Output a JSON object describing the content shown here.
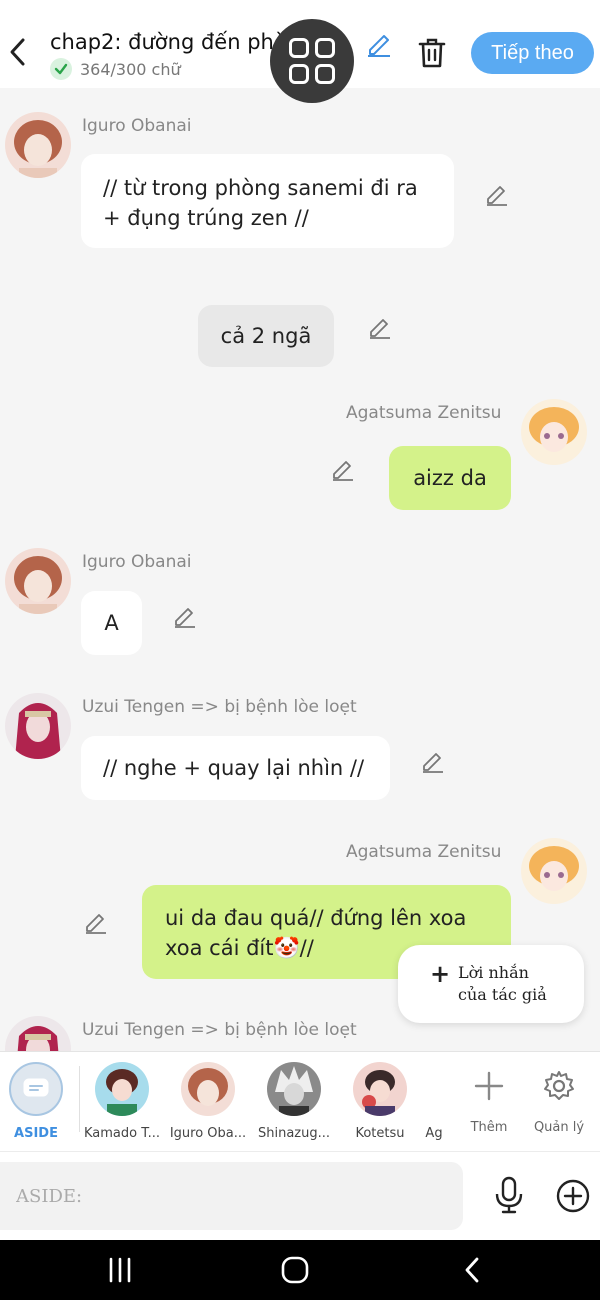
{
  "header": {
    "title": "chap2: đường đến phòng..",
    "word_count": "364/300 chữ",
    "next_label": "Tiếp theo",
    "next_color": "#5aaaf2"
  },
  "messages": [
    {
      "sender": "Iguro Obanai",
      "side": "left",
      "text_lines": [
        "// từ trong phòng sanemi đi ra",
        "+ đụng trúng zen //"
      ],
      "style": "white"
    },
    {
      "sender": "",
      "side": "center",
      "text_lines": [
        "cả 2 ngã"
      ],
      "style": "grey"
    },
    {
      "sender": "Agatsuma Zenitsu",
      "side": "right",
      "text_lines": [
        "aizz da"
      ],
      "style": "green"
    },
    {
      "sender": "Iguro Obanai",
      "side": "left",
      "text_lines": [
        "A"
      ],
      "style": "white"
    },
    {
      "sender": "Uzui Tengen => bị bệnh lòe loẹt",
      "side": "left",
      "text_lines": [
        "// nghe + quay lại nhìn //"
      ],
      "style": "white"
    },
    {
      "sender": "Agatsuma Zenitsu",
      "side": "right",
      "text_lines": [
        "ui da đau quá// đứng lên xoa",
        "xoa cái đít🤡//"
      ],
      "style": "green"
    },
    {
      "sender": "Uzui Tengen => bị bệnh lòe loẹt",
      "side": "left",
      "text_lines": [],
      "style": "white"
    }
  ],
  "author_note": {
    "plus": "+",
    "line1": "Lời nhắn",
    "line2": "của tác giả"
  },
  "characters": [
    {
      "label": "ASIDE",
      "icon": "chat-bubble-icon",
      "active": true
    },
    {
      "label": "Kamado T...",
      "icon": "avatar-kamado"
    },
    {
      "label": "Iguro Oba...",
      "icon": "avatar-iguro"
    },
    {
      "label": "Shinazug...",
      "icon": "avatar-shinazugawa"
    },
    {
      "label": "Kotetsu",
      "icon": "avatar-kotetsu"
    },
    {
      "label": "Ag",
      "icon": "avatar-agatsuma"
    }
  ],
  "tools": {
    "add_label": "Thêm",
    "manage_label": "Quản lý"
  },
  "composer": {
    "placeholder": "ASIDE:"
  },
  "colors": {
    "green_bubble": "#d4f28a",
    "accent_blue": "#3f8fe0",
    "background": "#f5f5f5"
  }
}
